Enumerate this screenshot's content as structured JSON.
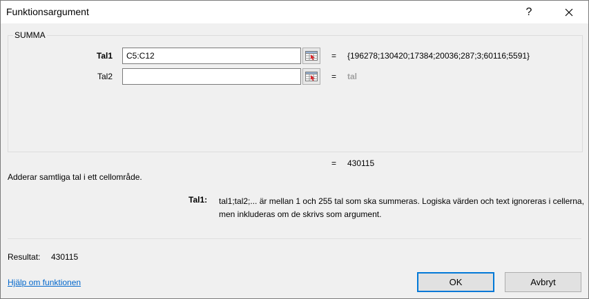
{
  "window": {
    "title": "Funktionsargument",
    "help_glyph": "?"
  },
  "function": {
    "name": "SUMMA"
  },
  "args": [
    {
      "label": "Tal1",
      "value": "C5:C12",
      "result": "{196278;130420;17384;20036;287;3;60116;5591}"
    },
    {
      "label": "Tal2",
      "value": "",
      "result": "tal"
    }
  ],
  "equals": "=",
  "formula_result": "430115",
  "description": "Adderar samtliga tal i ett cellområde.",
  "arg_description": {
    "name": "Tal1:",
    "text": "tal1;tal2;... är mellan 1 och 255 tal som ska summeras. Logiska värden och text ignoreras i cellerna, men inkluderas om de skrivs som argument."
  },
  "result": {
    "label": "Resultat:",
    "value": "430115"
  },
  "help_link": "Hjälp om funktionen",
  "buttons": {
    "ok": "OK",
    "cancel": "Avbryt"
  },
  "icons": {
    "close": "close-icon",
    "ref": "range-select-icon"
  }
}
